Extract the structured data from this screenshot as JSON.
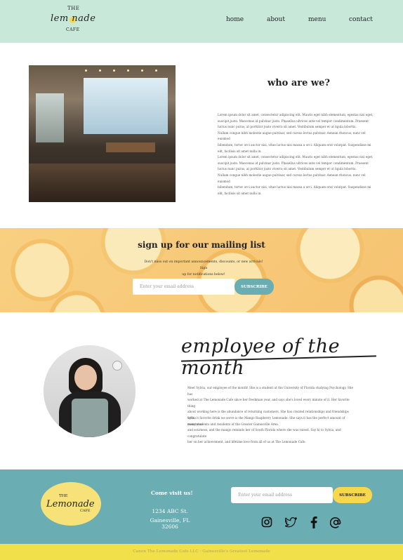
{
  "header": {
    "logo": {
      "the": "THE",
      "lemonade": "lem  nade",
      "cafe": "CAFE"
    },
    "nav": [
      {
        "label": "home"
      },
      {
        "label": "about"
      },
      {
        "label": "menu"
      },
      {
        "label": "contact"
      }
    ]
  },
  "about": {
    "title": "who are we?",
    "paragraphs": [
      "Lorem ipsum dolor sit amet, consectetur adipiscing elit. Mauris eget nibh elementum, egestas nisi eget,",
      "suscipit justo. Maecenas id pulvinar justo. Phasellus ultrices ante vel tempor condimentum. Praesent",
      "luctus nunc purus, at porttitor justo viverra sit amet. Vestibulum semper et ut ligula lobortis.",
      "Nullam congue nibh molestie augue pulvinar, sed cursus lectus pulvinar. Aenean rhoncus, nunc vel euismod",
      "bibendum, tortor orci auctor nisi, vitae luctus nisi massa a orci. Aliquam erat volutpat. Suspendisse mi",
      "elit, facilisis sit amet nulla in.",
      "Lorem ipsum dolor sit amet, consectetur adipiscing elit. Mauris eget nibh elementum, egestas nisi eget,",
      "suscipit justo. Maecenas id pulvinar justo. Phasellus ultrices ante vel tempor condimentum. Praesent",
      "luctus nunc purus, at porttitor justo viverra sit amet. Vestibulum semper et ut ligula lobortis.",
      "Nullam congue nibh molestie augue pulvinar, sed cursus lectus pulvinar. Aenean rhoncus, nunc vel euismod",
      "bibendum, tortor orci auctor nisi, vitae luctus nisi massa a orci. Aliquam erat volutpat. Suspendisse mi",
      "elit, facilisis sit amet nulla in."
    ]
  },
  "mailing": {
    "title": "sign up for our mailing list",
    "description_line1": "Don't miss out on important announcements, discounts, or new arrivals! Sign",
    "description_line2": "up for notifications below!",
    "email_placeholder": "Enter your email address",
    "subscribe_label": "SUBSCRIBE"
  },
  "employee": {
    "title": "employee of the month",
    "paragraph1": [
      "Meet Sylvia, our employee of the month! She is a student at the University of Florida studying Psychology. She has",
      "worked at The Lemonade Cafe since her freshman year, and says she's loved every minute of it. Her favorite thing",
      "about working here is the abundance of returning customers. She has created relationships and friendships with",
      "many students and residents of the Greater Gainesville Area."
    ],
    "paragraph2": [
      "Sylvia's favorite drink we serve is the Mango Raspberry Lemonade. She says it has the perfect amount of sweetness",
      "and sourness, and the mango reminds her of South Florida where she was raised. Say hi to Sylvia, and congratulate",
      "her on her achievement, and lifetime love from all of us at The Lemonade Cafe."
    ]
  },
  "footer": {
    "logo": {
      "the": "THE",
      "lemonade": "Lemonade",
      "cafe": "CAFE"
    },
    "visit_title": "Come visit us!",
    "address_line1": "1234 ABC St.",
    "address_line2": "Gainesville, FL 32606",
    "email_placeholder": "Enter your email address",
    "subscribe_label": "SUBSCRIBE",
    "social": [
      "instagram-icon",
      "twitter-icon",
      "facebook-icon",
      "at-icon"
    ],
    "copyright": "Canon The Lemonade Cafe LLC · Gainesville's Greatest Lemonade"
  },
  "colors": {
    "header_bg": "#c8e8da",
    "footer_bg": "#6aadb3",
    "bottom_bar": "#f2e04a",
    "subscribe_teal": "#6aadb3",
    "subscribe_yellow": "#f7d84a"
  }
}
